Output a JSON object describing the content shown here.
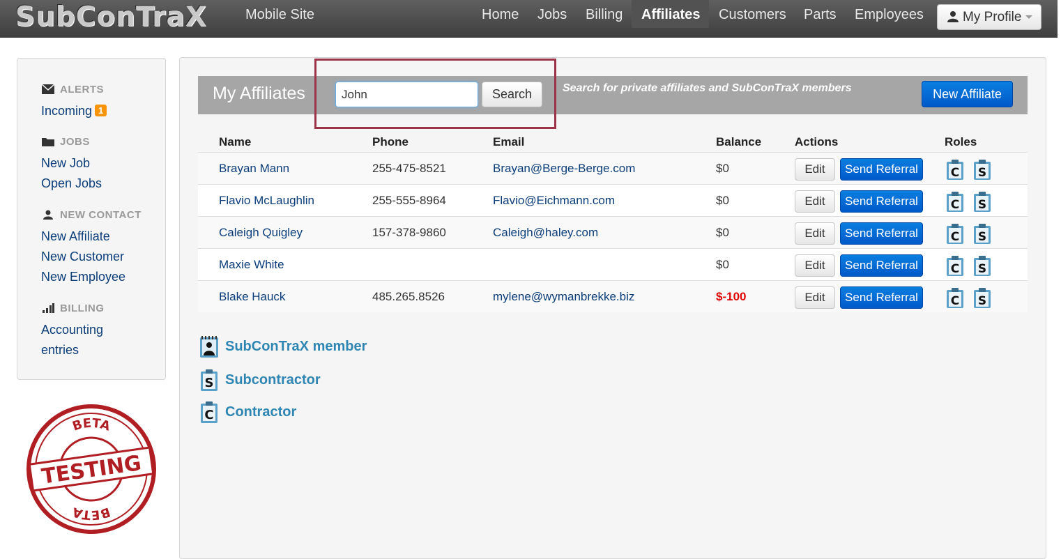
{
  "brand": "SubConTraX",
  "nav": {
    "mobile_site": "Mobile Site",
    "home": "Home",
    "jobs": "Jobs",
    "billing": "Billing",
    "affiliates": "Affiliates",
    "customers": "Customers",
    "parts": "Parts",
    "employees": "Employees",
    "profile": "My Profile"
  },
  "sidebar": {
    "alerts_header": "ALERTS",
    "incoming": "Incoming",
    "incoming_count": "1",
    "jobs_header": "JOBS",
    "new_job": "New Job",
    "open_jobs": "Open Jobs",
    "new_contact_header": "NEW CONTACT",
    "new_affiliate": "New Affiliate",
    "new_customer": "New Customer",
    "new_employee": "New Employee",
    "billing_header": "BILLING",
    "accounting_line1": "Accounting",
    "accounting_line2": "entries"
  },
  "stamp": {
    "top": "BETA",
    "middle": "TESTING",
    "bottom": "BETA"
  },
  "main": {
    "title": "My Affiliates",
    "search_value": "John",
    "search_button": "Search",
    "search_hint": "Search for private affiliates and SubConTraX members",
    "new_affiliate_button": "New Affiliate"
  },
  "table": {
    "headers": {
      "name": "Name",
      "phone": "Phone",
      "email": "Email",
      "balance": "Balance",
      "actions": "Actions",
      "roles": "Roles"
    },
    "edit_label": "Edit",
    "referral_label": "Send Referral",
    "rows": [
      {
        "name": "Brayan Mann",
        "phone": "255-475-8521",
        "email": "Brayan@Berge-Berge.com",
        "balance": "$0"
      },
      {
        "name": "Flavio McLaughlin",
        "phone": "255-555-8964",
        "email": "Flavio@Eichmann.com",
        "balance": "$0"
      },
      {
        "name": "Caleigh Quigley",
        "phone": "157-378-9860",
        "email": "Caleigh@haley.com",
        "balance": "$0"
      },
      {
        "name": "Maxie White",
        "phone": "",
        "email": "",
        "balance": "$0"
      },
      {
        "name": "Blake Hauck",
        "phone": "485.265.8526",
        "email": "mylene@wymanbrekke.biz",
        "balance": "$-100"
      }
    ]
  },
  "legend": {
    "member": "SubConTraX member",
    "subcontractor": "Subcontractor",
    "contractor": "Contractor"
  },
  "icons": {
    "role_c": "contractor-clipboard-icon",
    "role_s": "subcontractor-clipboard-icon",
    "member": "member-notebook-icon"
  },
  "colors": {
    "primary_button": "#0a6fd8",
    "highlight_box": "#9b3448",
    "negative_balance": "#e00000",
    "legend_text": "#2f86b3"
  }
}
